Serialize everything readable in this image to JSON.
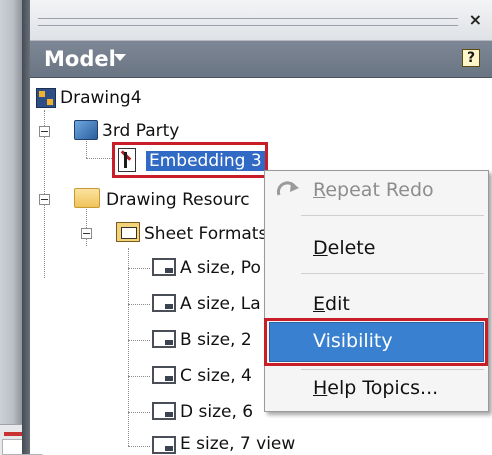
{
  "panel": {
    "title": "Model",
    "close_glyph": "×",
    "help_glyph": "?"
  },
  "tree": {
    "root": "Drawing4",
    "third_party": "3rd Party",
    "embedding": "Embedding 3",
    "resources": "Drawing Resourc",
    "sheet_formats": "Sheet Formats",
    "sheets": [
      "A size, Po",
      "A size, La",
      "B size, 2",
      "C size, 4",
      "D size, 6",
      "E size, 7 view"
    ]
  },
  "context_menu": {
    "items": [
      {
        "label": "Repeat Redo",
        "accel": "R",
        "rest": "epeat Redo",
        "disabled": true
      },
      {
        "label": "Delete",
        "accel": "D",
        "rest": "elete"
      },
      {
        "label": "Edit",
        "accel": "E",
        "rest": "dit"
      },
      {
        "label": "Visibility"
      },
      {
        "label": "Help Topics...",
        "accel": "H",
        "rest": "elp Topics..."
      }
    ]
  },
  "colors": {
    "selection": "#316ac5",
    "highlight_box": "#c81e28",
    "hover": "#3a80d0"
  }
}
